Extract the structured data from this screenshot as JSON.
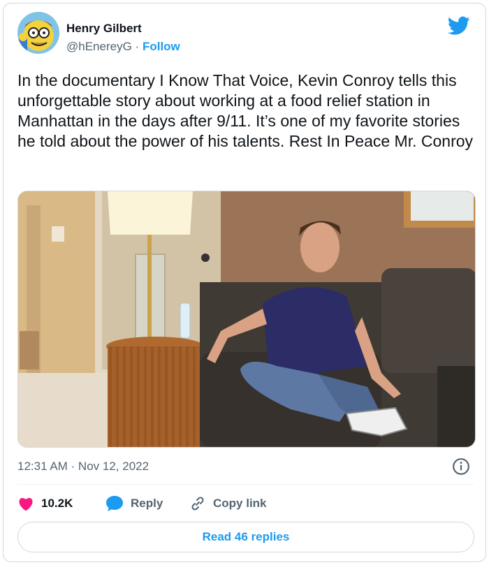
{
  "author": {
    "name": "Henry Gilbert",
    "handle": "@hEnereyG",
    "separator": "·",
    "follow_label": "Follow"
  },
  "tweet": {
    "text": "In the documentary I Know That Voice, Kevin Conroy tells this unforgettable story about working at a food relief station in Manhattan in the days after 9/11. It’s one of my favorite stories he told about the power of his talents. Rest In Peace Mr. Conroy",
    "timestamp": "12:31 AM · Nov 12, 2022"
  },
  "actions": {
    "likes": "10.2K",
    "reply_label": "Reply",
    "copy_link_label": "Copy link"
  },
  "replies": {
    "label": "Read 46 replies"
  },
  "colors": {
    "brand_blue": "#1d9bf0",
    "like_pink": "#f91880",
    "secondary_text": "#536471",
    "border": "#cfd9de"
  },
  "icons": [
    "twitter-bird-icon",
    "info-icon",
    "heart-icon",
    "reply-bubble-icon",
    "link-icon"
  ]
}
